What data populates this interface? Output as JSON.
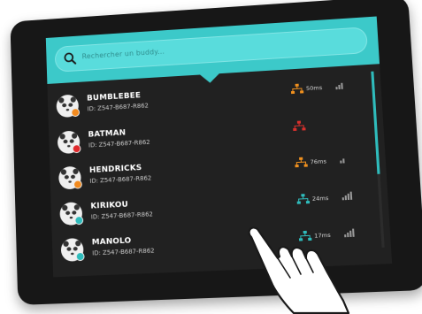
{
  "search": {
    "placeholder": "Rechercher un buddy..."
  },
  "colors": {
    "accent": "#3cc9c9",
    "status_orange": "#f28a1e",
    "status_red": "#e0292c",
    "status_teal": "#2fbcbc",
    "net_orange": "#f0901e",
    "net_red": "#d8302c",
    "net_teal": "#2fbcbc"
  },
  "buddies": [
    {
      "name": "BUMBLEBEE",
      "id": "ID: Z547-B687-R862",
      "status": "orange",
      "network_icon": "network-icon",
      "network_color": "orange",
      "ping": "50ms",
      "signal_level": 3
    },
    {
      "name": "BATMAN",
      "id": "ID: Z547-B687-R862",
      "status": "red",
      "network_icon": "network-icon",
      "network_color": "red",
      "ping": "",
      "signal_level": 0
    },
    {
      "name": "HENDRICKS",
      "id": "ID: Z547-B687-R862",
      "status": "orange",
      "network_icon": "network-icon",
      "network_color": "orange",
      "ping": "76ms",
      "signal_level": 2
    },
    {
      "name": "KIRIKOU",
      "id": "ID: Z547-B687-R862",
      "status": "teal",
      "network_icon": "network-icon",
      "network_color": "teal",
      "ping": "24ms",
      "signal_level": 4
    },
    {
      "name": "MANOLO",
      "id": "ID: Z547-B687-R862",
      "status": "teal",
      "network_icon": "network-icon",
      "network_color": "teal",
      "ping": "17ms",
      "signal_level": 4
    }
  ]
}
